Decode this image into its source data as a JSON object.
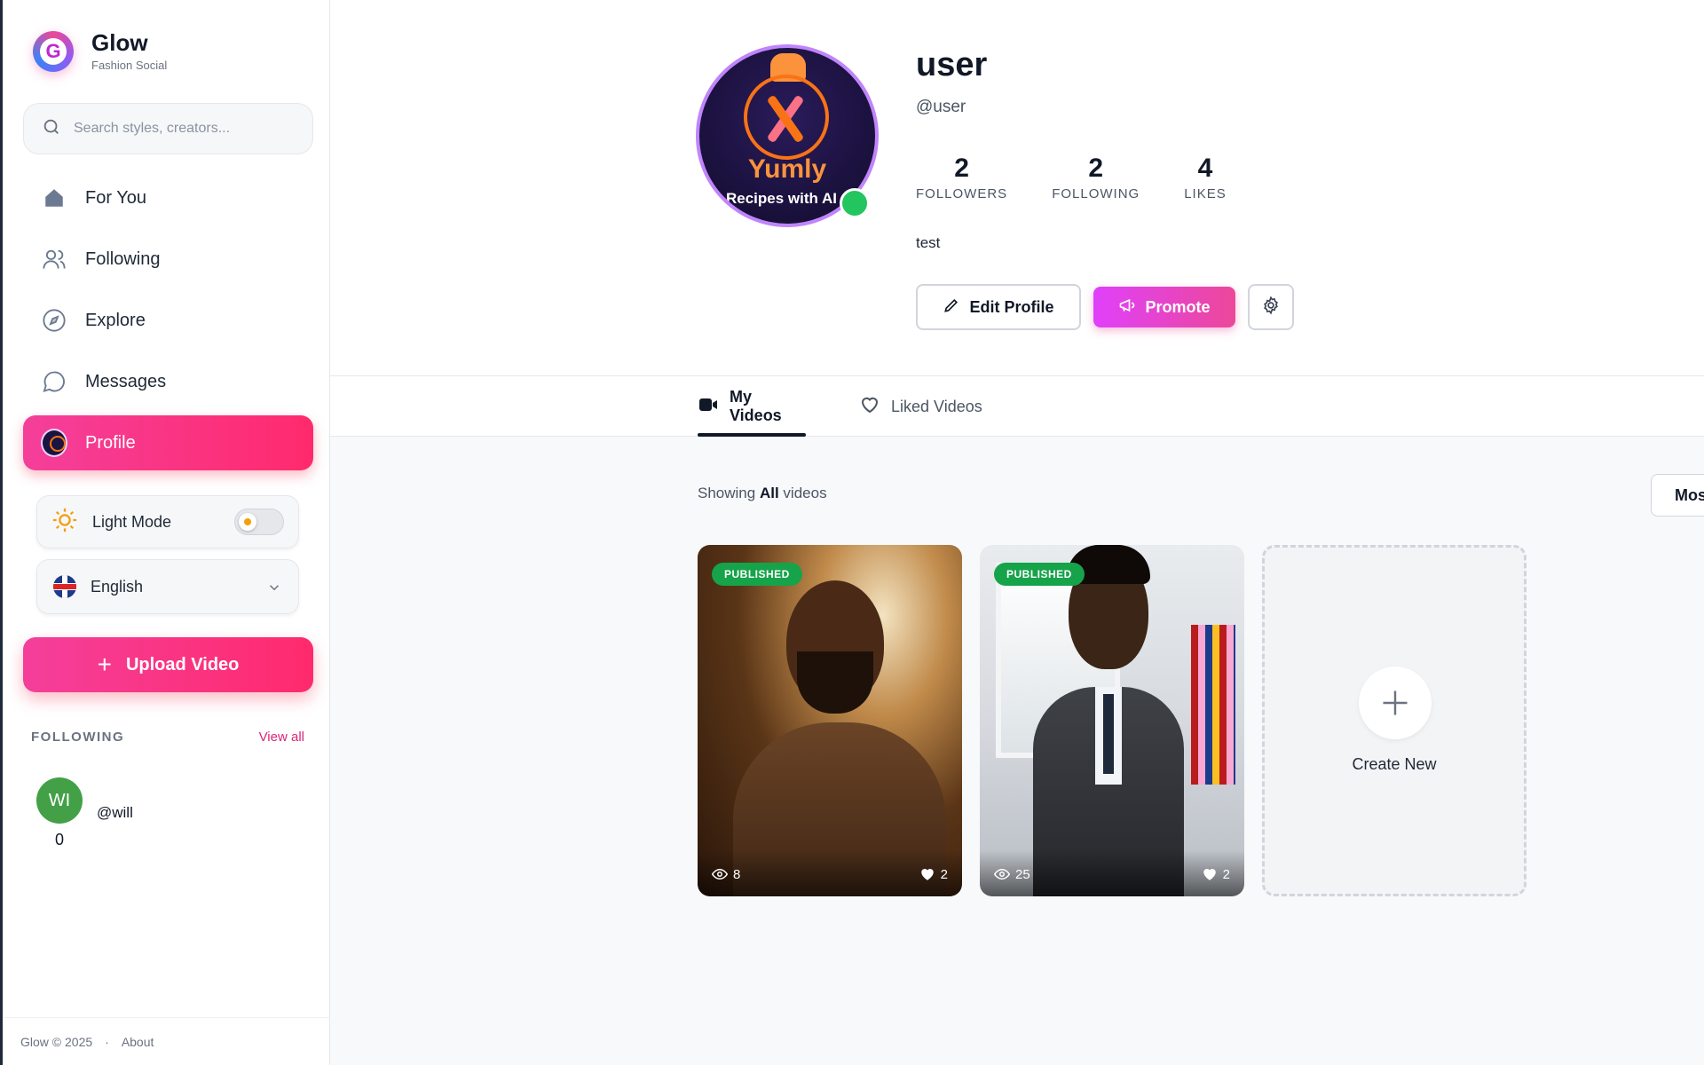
{
  "brand": {
    "name": "Glow",
    "tagline": "Fashion Social"
  },
  "search": {
    "placeholder": "Search styles, creators..."
  },
  "nav": [
    {
      "label": "For You",
      "icon": "home-icon"
    },
    {
      "label": "Following",
      "icon": "users-icon"
    },
    {
      "label": "Explore",
      "icon": "compass-icon"
    },
    {
      "label": "Messages",
      "icon": "chat-icon"
    },
    {
      "label": "Profile",
      "icon": "avatar",
      "active": true
    }
  ],
  "theme": {
    "label": "Light Mode",
    "enabled": false
  },
  "language": {
    "label": "English"
  },
  "upload": {
    "label": "Upload Video"
  },
  "following": {
    "title": "FOLLOWING",
    "view_all": "View all",
    "users": [
      {
        "initials": "WI",
        "handle": "@will",
        "count": "0"
      }
    ]
  },
  "footer": {
    "copyright": "Glow © 2025",
    "separator": "·",
    "about": "About"
  },
  "profile": {
    "username": "user",
    "handle": "@user",
    "avatar": {
      "title": "Yumly",
      "subtitle": "Recipes with AI"
    },
    "stats": [
      {
        "value": "2",
        "label": "FOLLOWERS"
      },
      {
        "value": "2",
        "label": "FOLLOWING"
      },
      {
        "value": "4",
        "label": "LIKES"
      }
    ],
    "bio": "test",
    "edit_label": "Edit Profile",
    "promote_label": "Promote"
  },
  "tabs": [
    {
      "label": "My Videos",
      "active": true
    },
    {
      "label": "Liked Videos",
      "active": false
    }
  ],
  "filter": {
    "prefix": "Showing",
    "value": "All",
    "suffix": "videos",
    "sort_label": "Mos"
  },
  "videos": [
    {
      "status": "PUBLISHED",
      "views": "8",
      "likes": "2"
    },
    {
      "status": "PUBLISHED",
      "views": "25",
      "likes": "2"
    }
  ],
  "create": {
    "label": "Create New"
  },
  "colors": {
    "accent": "#ff2a6d",
    "promote": "#e040fb",
    "published": "#16a34a",
    "online": "#22c55e"
  }
}
